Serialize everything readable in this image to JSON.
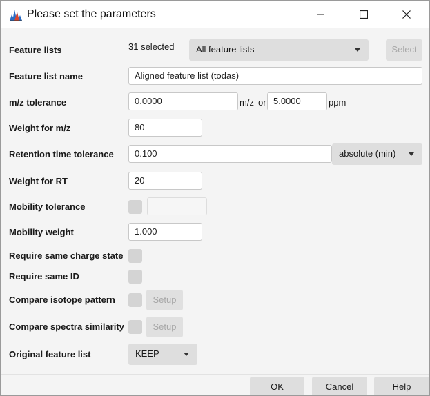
{
  "window": {
    "title": "Please set the parameters",
    "icon": "app-chart-icon"
  },
  "rows": {
    "feature_lists": {
      "label": "Feature lists",
      "selected_text": "31 selected",
      "combo_value": "All feature lists",
      "select_button": "Select"
    },
    "feature_list_name": {
      "label": "Feature list name",
      "value": "Aligned feature list (todas)"
    },
    "mz_tolerance": {
      "label": "m/z tolerance",
      "mz_value": "0.0000",
      "mz_unit": "m/z",
      "or_text": "or",
      "ppm_value": "5.0000",
      "ppm_unit": "ppm"
    },
    "weight_mz": {
      "label": "Weight for m/z",
      "value": "80"
    },
    "rt_tolerance": {
      "label": "Retention time tolerance",
      "value": "0.100",
      "unit_combo": "absolute (min)"
    },
    "weight_rt": {
      "label": "Weight for RT",
      "value": "20"
    },
    "mobility_tolerance": {
      "label": "Mobility tolerance",
      "checked": false,
      "value": ""
    },
    "mobility_weight": {
      "label": "Mobility weight",
      "value": "1.000"
    },
    "same_charge": {
      "label": "Require same charge state",
      "checked": false
    },
    "same_id": {
      "label": "Require same ID",
      "checked": false
    },
    "isotope_pattern": {
      "label": "Compare isotope pattern",
      "checked": false,
      "setup_button": "Setup"
    },
    "spectra_similarity": {
      "label": "Compare spectra similarity",
      "checked": false,
      "setup_button": "Setup"
    },
    "original_list": {
      "label": "Original feature list",
      "combo_value": "KEEP"
    }
  },
  "footer": {
    "ok": "OK",
    "cancel": "Cancel",
    "help": "Help"
  }
}
